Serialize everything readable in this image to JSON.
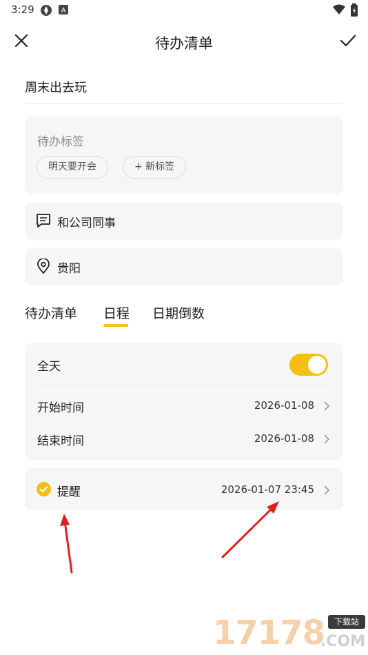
{
  "status_bar": {
    "time": "3:29"
  },
  "header": {
    "title": "待办清单"
  },
  "todo": {
    "title": "周末出去玩"
  },
  "tags": {
    "label": "待办标签",
    "chips": [
      "明天要开会",
      "+ 新标签"
    ]
  },
  "note": {
    "text": "和公司同事"
  },
  "location": {
    "text": "贵阳"
  },
  "tabs": [
    {
      "label": "待办清单",
      "active": false
    },
    {
      "label": "日程",
      "active": true
    },
    {
      "label": "日期倒数",
      "active": false
    }
  ],
  "schedule": {
    "all_day_label": "全天",
    "all_day_on": true,
    "start_label": "开始时间",
    "start_value": "2026-01-08",
    "end_label": "结束时间",
    "end_value": "2026-01-08"
  },
  "reminder": {
    "label": "提醒",
    "value": "2026-01-07 23:45"
  },
  "watermark": {
    "number": "17178",
    "badge": "下载站",
    "suffix": ".COM"
  },
  "colors": {
    "accent": "#f5bf13",
    "card_bg": "#f6f6f6",
    "annotation_arrow": "#e02020"
  }
}
